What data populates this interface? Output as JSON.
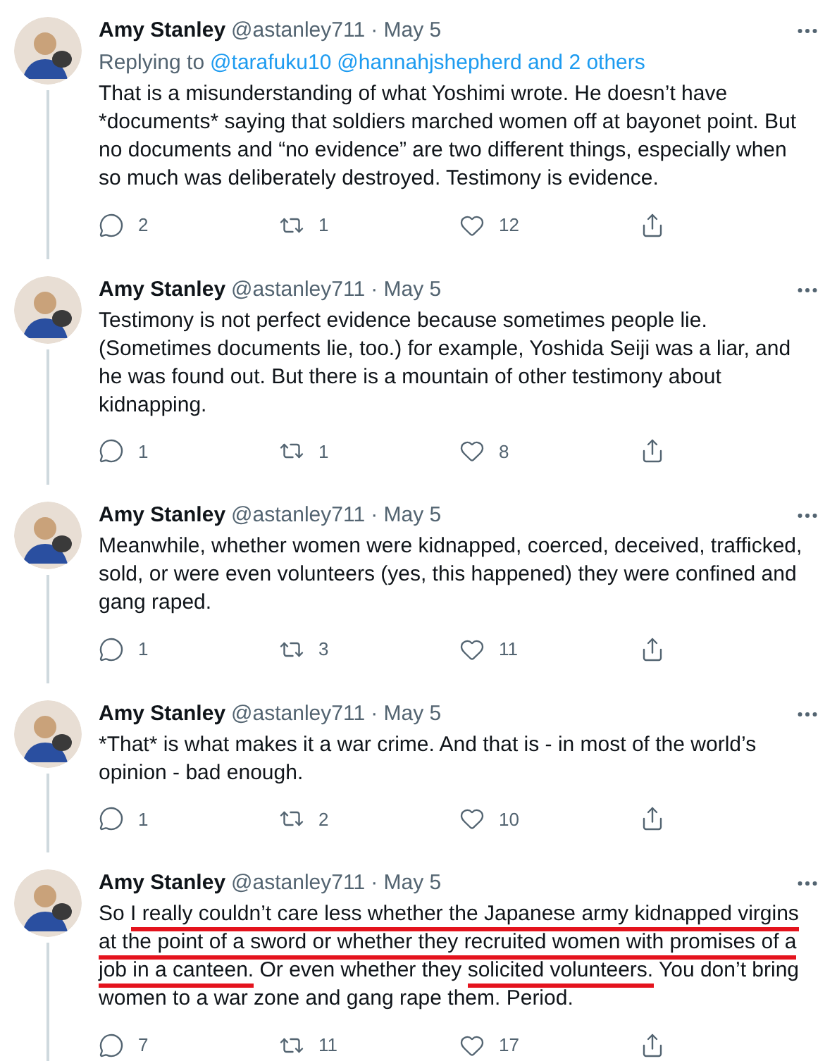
{
  "tweets": [
    {
      "name": "Amy Stanley",
      "handle": "@astanley711",
      "time": "· May 5",
      "replying_to": {
        "label": "Replying to",
        "links": [
          "@tarafuku10",
          "@hannahjshepherd and 2 others"
        ]
      },
      "body": [
        {
          "text": "That is a misunderstanding of what Yoshimi wrote. He doesn’t have *documents* saying that soldiers marched women off at bayonet point. But no documents and “no evidence” are two different things, especially when so much was deliberately destroyed. Testimony is evidence."
        }
      ],
      "actions": [
        {
          "kind": "reply",
          "count": "2"
        },
        {
          "kind": "retweet",
          "count": "1"
        },
        {
          "kind": "like",
          "count": "12"
        },
        {
          "kind": "share"
        }
      ]
    },
    {
      "name": "Amy Stanley",
      "handle": "@astanley711",
      "time": "· May 5",
      "body": [
        {
          "text": "Testimony is not perfect evidence because sometimes people lie. (Sometimes documents lie, too.) for example, Yoshida Seiji was a liar, and he was found out. But there is a mountain of other testimony about kidnapping."
        }
      ],
      "actions": [
        {
          "kind": "reply",
          "count": "1"
        },
        {
          "kind": "retweet",
          "count": "1"
        },
        {
          "kind": "like",
          "count": "8"
        },
        {
          "kind": "share"
        }
      ]
    },
    {
      "name": "Amy Stanley",
      "handle": "@astanley711",
      "time": "· May 5",
      "body": [
        {
          "text": "Meanwhile, whether women were kidnapped, coerced, deceived, trafficked, sold, or were even volunteers (yes, this happened) they were confined and gang raped."
        }
      ],
      "actions": [
        {
          "kind": "reply",
          "count": "1"
        },
        {
          "kind": "retweet",
          "count": "3"
        },
        {
          "kind": "like",
          "count": "11"
        },
        {
          "kind": "share"
        }
      ]
    },
    {
      "name": "Amy Stanley",
      "handle": "@astanley711",
      "time": "· May 5",
      "body": [
        {
          "text": "*That* is what makes it a war crime. And that is - in most of the world’s opinion - bad enough."
        }
      ],
      "actions": [
        {
          "kind": "reply",
          "count": "1"
        },
        {
          "kind": "retweet",
          "count": "2"
        },
        {
          "kind": "like",
          "count": "10"
        },
        {
          "kind": "share"
        }
      ]
    },
    {
      "name": "Amy Stanley",
      "handle": "@astanley711",
      "time": "· May 5",
      "body": [
        {
          "text": "So ",
          "underlined": false
        },
        {
          "text": "I really couldn’t care less whether the Japanese army kidnapped virgins at the point of a sword or whether they recruited women with promises of a job in a canteen.",
          "underlined": true
        },
        {
          "text": " Or even whether they ",
          "underlined": false
        },
        {
          "text": "solicited volunteers.",
          "underlined": true
        },
        {
          "text": " You don’t bring women to a war zone and gang rape them. Period.",
          "underlined": false
        }
      ],
      "actions": [
        {
          "kind": "reply",
          "count": "7"
        },
        {
          "kind": "retweet",
          "count": "11"
        },
        {
          "kind": "like",
          "count": "17"
        },
        {
          "kind": "share"
        }
      ]
    }
  ]
}
